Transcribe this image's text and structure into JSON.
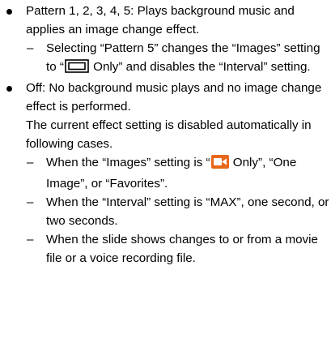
{
  "items": [
    {
      "text": "Pattern 1, 2, 3, 4, 5: Plays background music and applies an image change effect.",
      "subitems": [
        {
          "before": "Selecting “Pattern 5” changes the “Images” setting to “",
          "icon": "rectangle-image-icon",
          "after": " Only” and disables the “Interval” setting."
        }
      ]
    },
    {
      "text": "Off: No background music plays and no image change effect is performed.",
      "extra": "The current effect setting is disabled automatically in following cases.",
      "subitems": [
        {
          "before": "When the “Images” setting is “",
          "icon": "movie-icon",
          "after": " Only”, “One Image”, or “Favorites”."
        },
        {
          "text": "When the “Interval” setting is “MAX”, one second, or two seconds."
        },
        {
          "text": "When the slide shows changes to or from a movie file or a voice recording file."
        }
      ]
    }
  ],
  "dash": "–",
  "colors": {
    "text": "#000000",
    "icon_orange": "#e8681a",
    "background": "#ffffff"
  }
}
